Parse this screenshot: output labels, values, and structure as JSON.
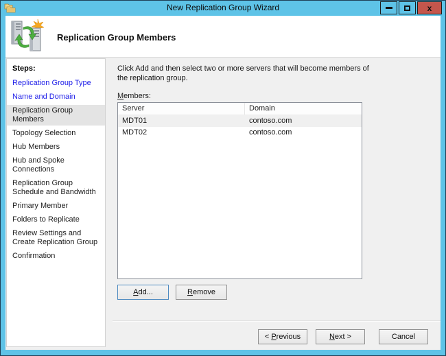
{
  "window": {
    "title": "New Replication Group Wizard",
    "close_glyph": "x"
  },
  "header": {
    "title": "Replication Group Members"
  },
  "sidebar": {
    "heading": "Steps:",
    "items": [
      {
        "label": "Replication Group Type",
        "state": "link"
      },
      {
        "label": "Name and Domain",
        "state": "link"
      },
      {
        "label": "Replication Group Members",
        "state": "current"
      },
      {
        "label": "Topology Selection",
        "state": "normal"
      },
      {
        "label": "Hub Members",
        "state": "normal"
      },
      {
        "label": "Hub and Spoke Connections",
        "state": "normal"
      },
      {
        "label": "Replication Group Schedule and Bandwidth",
        "state": "normal"
      },
      {
        "label": "Primary Member",
        "state": "normal"
      },
      {
        "label": "Folders to Replicate",
        "state": "normal"
      },
      {
        "label": "Review Settings and Create Replication Group",
        "state": "normal"
      },
      {
        "label": "Confirmation",
        "state": "normal"
      }
    ]
  },
  "main": {
    "description": "Click Add and then select two or more servers that will become members of the replication group.",
    "members_label": "Members:",
    "table": {
      "columns": [
        "Server",
        "Domain"
      ],
      "rows": [
        {
          "server": "MDT01",
          "domain": "contoso.com",
          "selected": true
        },
        {
          "server": "MDT02",
          "domain": "contoso.com",
          "selected": false
        }
      ]
    },
    "buttons": {
      "add": "Add...",
      "remove": "Remove"
    }
  },
  "footer": {
    "previous": "< Previous",
    "next": "Next >",
    "cancel": "Cancel"
  },
  "colors": {
    "frame-blue": "#5ec3e7",
    "frame-outline": "#1e3f55",
    "close-red": "#c4564c",
    "content-bg": "#f0f0f0",
    "link-blue": "#1c1ce8",
    "step-highlight": "#e4e4e4",
    "row-selected": "#f0f0f0",
    "focus-blue": "#4d8ac0"
  }
}
